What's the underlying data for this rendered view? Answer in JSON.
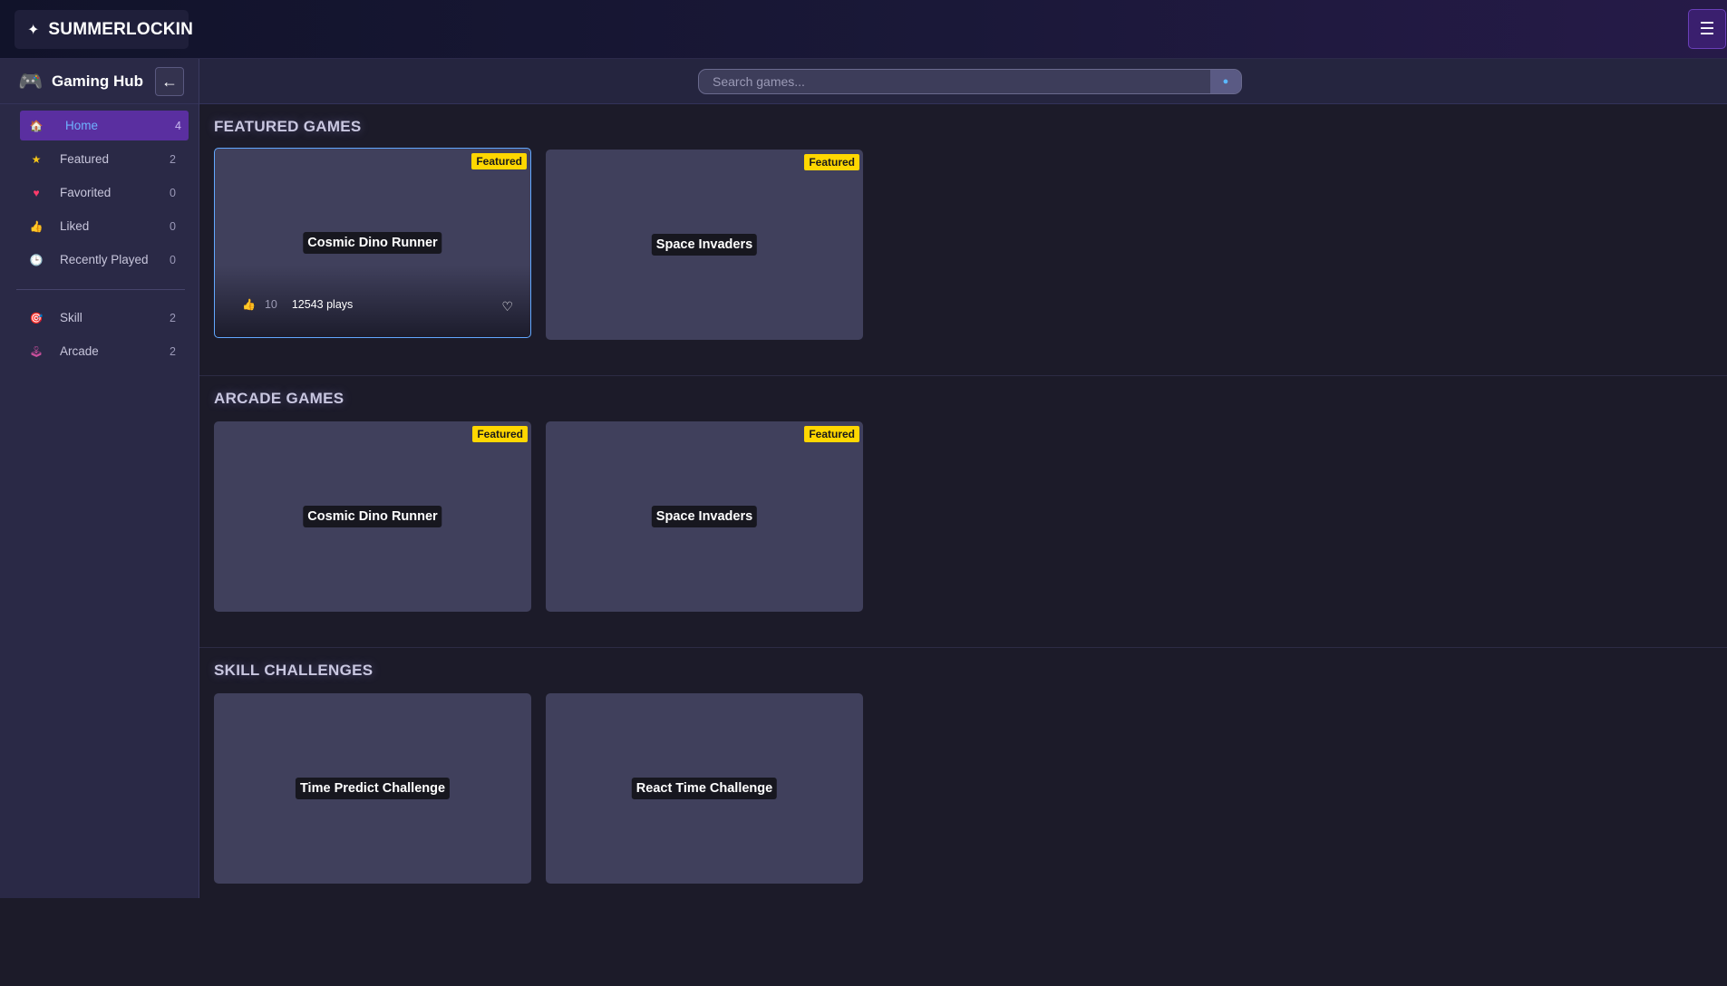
{
  "header": {
    "brand": "SUMMERLOCKIN",
    "logo_icon": "sparkle-icon",
    "menu_icon": "hamburger-icon",
    "menu_glyph": "☰"
  },
  "sidebar": {
    "title": "Gaming Hub",
    "title_icon": "gamepad-icon",
    "back_glyph": "←",
    "items": [
      {
        "label": "Home",
        "count": "4",
        "icon": "home-icon",
        "active": true
      },
      {
        "label": "Featured",
        "count": "2",
        "icon": "star-icon"
      },
      {
        "label": "Favorited",
        "count": "0",
        "icon": "heart-icon"
      },
      {
        "label": "Liked",
        "count": "0",
        "icon": "thumbs-up-icon"
      },
      {
        "label": "Recently Played",
        "count": "0",
        "icon": "clock-icon"
      }
    ],
    "categories": [
      {
        "label": "Skill",
        "count": "2",
        "icon": "target-icon"
      },
      {
        "label": "Arcade",
        "count": "2",
        "icon": "joystick-icon"
      }
    ]
  },
  "search": {
    "placeholder": "Search games...",
    "button_icon": "search-icon"
  },
  "sections": [
    {
      "title": "FEATURED GAMES",
      "cards": [
        {
          "title": "Cosmic Dino Runner",
          "badge": "Featured",
          "likes": "10",
          "plays": "12543 plays"
        },
        {
          "title": "Space Invaders",
          "badge": "Featured"
        }
      ]
    },
    {
      "title": "ARCADE GAMES",
      "cards": [
        {
          "title": "Cosmic Dino Runner",
          "badge": "Featured"
        },
        {
          "title": "Space Invaders",
          "badge": "Featured"
        }
      ]
    },
    {
      "title": "SKILL CHALLENGES",
      "cards": [
        {
          "title": "Time Predict Challenge"
        },
        {
          "title": "React Time Challenge"
        }
      ]
    }
  ],
  "colors": {
    "accent": "#5a2fa0",
    "badge": "#ffd700",
    "link": "#6fb2ff"
  }
}
